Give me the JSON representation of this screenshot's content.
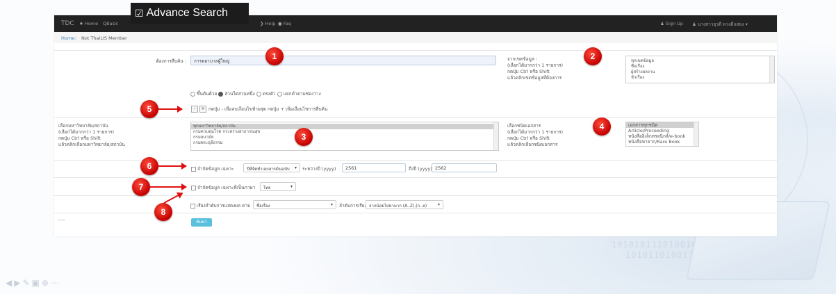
{
  "navbar": {
    "brand": "TDC",
    "home": "Home",
    "basic": "Basic",
    "active_tab": "Advance Search",
    "help": "Help",
    "faq": "Faq",
    "sign_up": "Sign Up",
    "user": "นางสาวยุวดี พวงดีแสยง"
  },
  "breadcrumb": {
    "home": "Home",
    "sep": "/",
    "current": "Not ThaiLIS Member"
  },
  "keyword": {
    "label": "ต้องการสืบค้น :",
    "value": "การพยาบาลผู้ใหญ่"
  },
  "field_source": {
    "label": "จากเขตข้อมูล :\n(เลือกได้มากกว่า 1 รายการ)\nกดปุ่ม Ctrl หรือ Shift\nแล้วคลิกเขตข้อมูลที่ต้องการ",
    "options": [
      "ทุกเขตข้อมูล",
      "ชื่อเรื่อง",
      "ผู้สร้างผลงาน",
      "หัวเรื่อง"
    ]
  },
  "match_options": [
    "ขึ้นต้นด้วย",
    "ส่วนใดส่วนหนึ่ง",
    "ตรงตัว",
    "แยกคำตามช่องว่าง"
  ],
  "add_row_text": "กดปุ่ม - เพื่อลบเงื่อนไขท้ายสุด กดปุ่ม + เพิ่มเงื่อนไขการสืบค้น",
  "institution": {
    "label": "เลือกมหาวิทยาลัย/สถาบัน\n(เลือกได้มากกว่า 1 รายการ)\nกดปุ่ม Ctrl หรือ Shift\nแล้วคลิกเลือกมหาวิทยาลัย/สถาบัน",
    "options": [
      "ทุกมหาวิทยาลัย/สถาบัน",
      "กรมควบคุมโรค กระทรวงสาธารณสุข",
      "กรมอนามัย",
      "กรมพระอุลีธรรม"
    ]
  },
  "doc_type": {
    "label": "เลือกชนิดเอกสาร\n(เลือกได้มากกว่า 1 รายการ)\nกดปุ่ม Ctrl หรือ Shift\nแล้วคลิกเลือกชนิดเอกสาร",
    "options": [
      "เอกสารทุกชนิด",
      "Article/Proceeding",
      "หนังสืออิเล็กทรอนิกส์/e-book",
      "หนังสือหายาก/Rare Book"
    ]
  },
  "year_filter": {
    "label": "จำกัดข้อมูล เฉพาะ",
    "select": "ปีที่จัดทำเอกสารต้นฉบับ",
    "between": "ระหว่างปี (yyyy)",
    "from": "2561",
    "to_label": "ถึงปี (yyyy)",
    "to": "2562"
  },
  "lang_filter": {
    "label": "จำกัดข้อมูล เฉพาะที่เป็นภาษา",
    "select": "ไทย"
  },
  "sort": {
    "label": "เรียงลำดับการแสดงผล ตาม",
    "field": "ชื่อเรื่อง",
    "order_label": "ลำดับการเรียง",
    "order": "จากน้อยไปหามาก (A..Z),(ก..ฮ)"
  },
  "search_button": "ค้นหา",
  "ellipsis": "----",
  "badges": [
    "1",
    "2",
    "3",
    "4",
    "5",
    "6",
    "7",
    "8"
  ],
  "colors": {
    "navbar": "#222222",
    "badge": "#d10000",
    "arrow": "#e01010",
    "button": "#5bc0de"
  }
}
